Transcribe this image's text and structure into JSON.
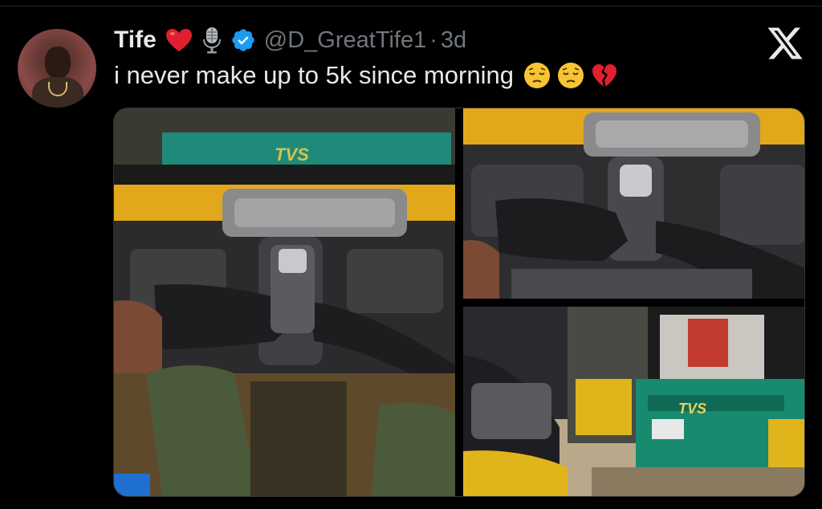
{
  "tweet": {
    "author_name": "Tife",
    "handle": "@D_GreatTife1",
    "separator": "·",
    "time_ago": "3d",
    "text": "i never make up to 5k since morning",
    "name_badges": [
      "red-heart-icon",
      "microphone-icon",
      "verified-badge-icon"
    ],
    "text_emojis": [
      "pensive-face-icon",
      "pensive-face-icon",
      "broken-heart-icon"
    ]
  },
  "media": {
    "count": 3,
    "photos": [
      {
        "name": "photo-tricycle-handlebar"
      },
      {
        "name": "photo-handlebar-closeup"
      },
      {
        "name": "photo-keke-tricycles-parked",
        "sign_text": "TVS"
      }
    ]
  },
  "colors": {
    "background": "#000000",
    "text": "#e7e9ea",
    "secondary_text": "#71767b",
    "verified": "#1d9bf0",
    "heart": "#f91880"
  }
}
